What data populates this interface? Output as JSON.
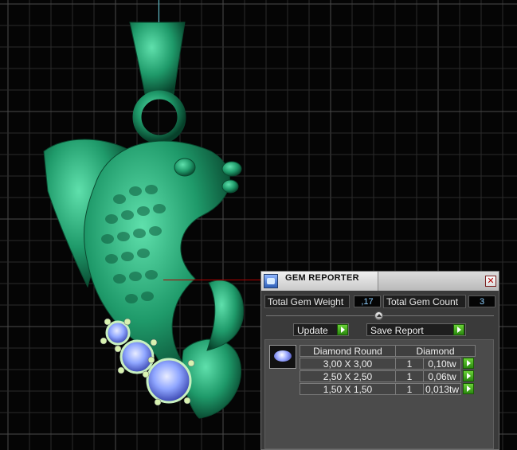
{
  "panel": {
    "title": "GEM REPORTER",
    "close_glyph": "✕",
    "total_weight_label": "Total Gem Weight",
    "total_weight_value": ",17",
    "total_count_label": "Total Gem Count",
    "total_count_value": "3",
    "update_label": "Update",
    "save_report_label": "Save Report"
  },
  "table": {
    "header_shape": "Diamond Round",
    "header_material": "Diamond",
    "rows": [
      {
        "size": "3,00 X 3,00",
        "qty": "1",
        "weight": "0,10tw"
      },
      {
        "size": "2,50 X 2,50",
        "qty": "1",
        "weight": "0,06tw"
      },
      {
        "size": "1,50 X 1,50",
        "qty": "1",
        "weight": "0,013tw"
      }
    ]
  },
  "icons": {
    "app": "gem-reporter-icon",
    "close": "close-icon",
    "arrow": "play-arrow-icon",
    "gem": "round-diamond-icon"
  },
  "colors": {
    "model_green": "#1f9a6a",
    "gem_blue": "#8fa6ff",
    "accent_button": "#3fae1c",
    "value_text": "#8fd0ff"
  }
}
